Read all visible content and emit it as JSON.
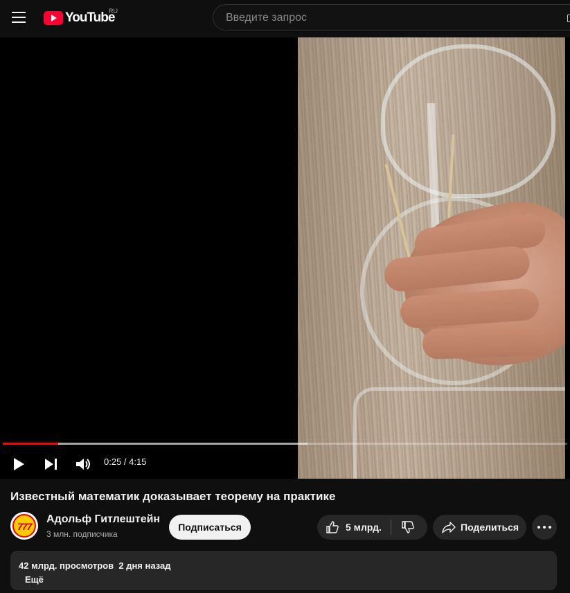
{
  "header": {
    "logo_text": "YouTube",
    "region": "RU",
    "search_placeholder": "Введите запрос"
  },
  "player": {
    "time_display": "0:25 / 4:15",
    "progress_fraction": 0.098,
    "buffered_fraction": 0.54,
    "progress_color": "#ff0000"
  },
  "video": {
    "title": "Известный математик доказывает теорему на практике"
  },
  "channel": {
    "avatar_text": "777",
    "name": "Адольф Гитлештейн",
    "subscribers": "3 млн. подписчика",
    "subscribe_label": "Подписаться"
  },
  "actions": {
    "likes": "5 млрд.",
    "share_label": "Поделиться"
  },
  "description": {
    "stats": "42 млрд. просмотров  2 дня назад",
    "more_label": "Ещё"
  },
  "colors": {
    "background": "#0f0f0f",
    "surface": "#272727",
    "brand_red": "#ff0033"
  }
}
